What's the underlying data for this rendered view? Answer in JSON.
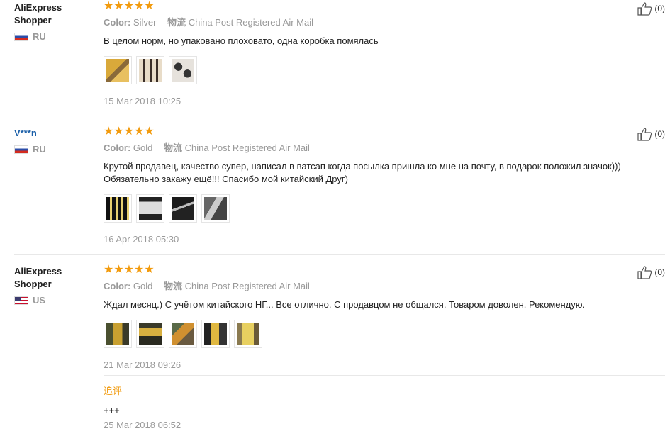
{
  "labels": {
    "color": "Color:",
    "shipping": "物流",
    "followup": "追评"
  },
  "reviews": [
    {
      "user": "AliExpress Shopper",
      "country": "RU",
      "stars": "★★★★★",
      "color": "Silver",
      "shipping": "China Post Registered Air Mail",
      "text": "В целом норм, но упаковано плоховато, одна коробка помялась",
      "date": "15 Mar 2018 10:25",
      "likes": "(0)",
      "images": [
        "photo-1",
        "photo-2",
        "photo-3"
      ]
    },
    {
      "user": "V***n",
      "country": "RU",
      "stars": "★★★★★",
      "color": "Gold",
      "shipping": "China Post Registered Air Mail",
      "text": "Крутой продавец, качество супер, написал в ватсап когда посылка пришла ко мне на почту, в подарок положил значок))) Обязательно закажу ещё!!! Спасибо мой китайский Друг)",
      "date": "16 Apr 2018 05:30",
      "likes": "(0)",
      "images": [
        "photo-1",
        "photo-2",
        "photo-3",
        "photo-4"
      ]
    },
    {
      "user": "AliExpress Shopper",
      "country": "US",
      "stars": "★★★★★",
      "color": "Gold",
      "shipping": "China Post Registered Air Mail",
      "text": "Ждал месяц.) С учётом китайского НГ... Все отлично. С продавцом не общался. Товаром доволен. Рекомендую.",
      "date": "21 Mar 2018 09:26",
      "likes": "(0)",
      "images": [
        "photo-1",
        "photo-2",
        "photo-3",
        "photo-4",
        "photo-5"
      ],
      "followup": {
        "text": "+++",
        "date": "25 Mar 2018 06:52"
      }
    }
  ]
}
